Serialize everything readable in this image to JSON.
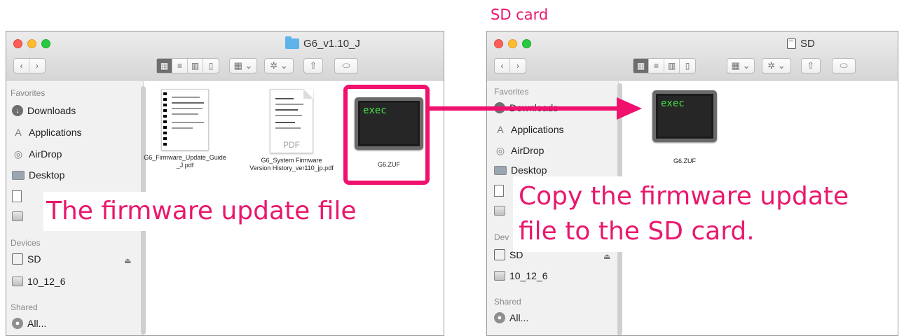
{
  "caption_sd": "SD card",
  "callout_left": "The firmware update file",
  "callout_right_line1": "Copy the firmware update",
  "callout_right_line2": "file to the SD card.",
  "accent_color": "#f0106e",
  "window_left": {
    "title": "G6_v1.10_J",
    "title_icon": "folder-icon",
    "sidebar": {
      "favorites_heading": "Favorites",
      "favorites": [
        "Downloads",
        "Applications",
        "AirDrop",
        "Desktop"
      ],
      "devices_heading": "Devices",
      "devices": [
        "SD",
        "10_12_6"
      ],
      "shared_heading": "Shared",
      "shared": [
        "All..."
      ]
    },
    "files": {
      "guide_line1": "G6_Firmware_Update_Guide",
      "guide_line2": "_J.pdf",
      "history_line1": "G6_System Firmware",
      "history_line2": "Version History_ver110_jp.pdf",
      "history_badge": "PDF",
      "zuf_name": "G6.ZUF",
      "zuf_icon_text": "exec"
    }
  },
  "window_right": {
    "title": "SD",
    "title_icon": "sd-card-icon",
    "sidebar": {
      "favorites_heading": "Favorites",
      "favorites": [
        "Downloads",
        "Applications",
        "AirDrop",
        "Desktop"
      ],
      "devices_heading": "Dev",
      "devices": [
        "SD",
        "10_12_6"
      ],
      "shared_heading": "Shared",
      "shared": [
        "All..."
      ]
    },
    "files": {
      "zuf_name": "G6.ZUF",
      "zuf_icon_text": "exec"
    }
  },
  "toolbar": {
    "nav_back": "‹",
    "nav_forward": "›",
    "view_icon": "▦",
    "view_list": "≡",
    "view_columns": "▥",
    "view_cover": "▯",
    "arrange": "▦ ⌄",
    "action": "✲ ⌄",
    "share": "⇧",
    "tags": "⬭"
  },
  "sidebar_icons": {
    "downloads": "↓",
    "applications": "A",
    "airdrop": "◎",
    "documents": "▤",
    "all": "●"
  }
}
